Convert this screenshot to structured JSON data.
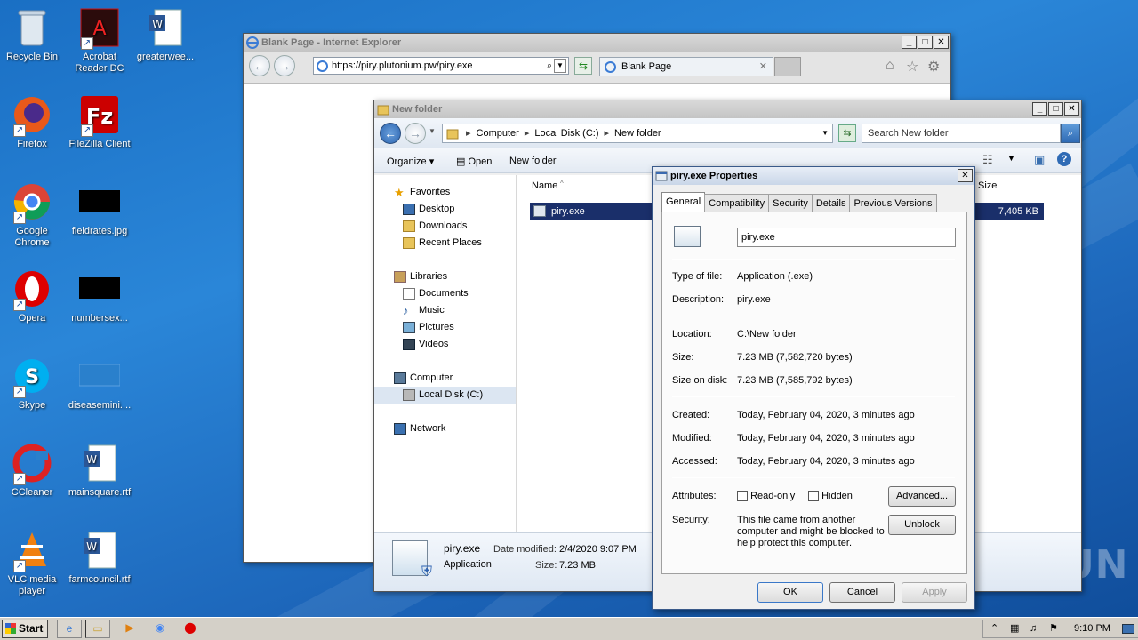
{
  "desktop": {
    "icons": [
      {
        "label": "Recycle Bin"
      },
      {
        "label": "Acrobat Reader DC"
      },
      {
        "label": "greaterwee..."
      },
      {
        "label": "Firefox"
      },
      {
        "label": "FileZilla Client"
      },
      {
        "label": "Google Chrome"
      },
      {
        "label": "fieldrates.jpg"
      },
      {
        "label": "Opera"
      },
      {
        "label": "numbersex..."
      },
      {
        "label": "Skype"
      },
      {
        "label": "diseasemini...."
      },
      {
        "label": "CCleaner"
      },
      {
        "label": "mainsquare.rtf"
      },
      {
        "label": "VLC media player"
      },
      {
        "label": "farmcouncil.rtf"
      }
    ],
    "watermark": "ANY RUN"
  },
  "ie": {
    "title": "Blank Page - Internet Explorer",
    "url": "https://piry.plutonium.pw/piry.exe",
    "tab_label": "Blank Page"
  },
  "explorer": {
    "title": "New folder",
    "breadcrumb": [
      "Computer",
      "Local Disk (C:)",
      "New folder"
    ],
    "search_placeholder": "Search New folder",
    "commands": {
      "organize": "Organize",
      "open": "Open",
      "new_folder": "New folder"
    },
    "nav": {
      "favorites": "Favorites",
      "desktop": "Desktop",
      "downloads": "Downloads",
      "recent": "Recent Places",
      "libraries": "Libraries",
      "documents": "Documents",
      "music": "Music",
      "pictures": "Pictures",
      "videos": "Videos",
      "computer": "Computer",
      "local_disk": "Local Disk (C:)",
      "network": "Network"
    },
    "columns": {
      "name": "Name",
      "size": "Size"
    },
    "file": {
      "name": "piry.exe",
      "size": "7,405 KB"
    },
    "details": {
      "name": "piry.exe",
      "type": "Application",
      "modified_label": "Date modified:",
      "modified": "2/4/2020 9:07 PM",
      "size_label": "Size:",
      "size": "7.23 MB"
    }
  },
  "props": {
    "title": "piry.exe Properties",
    "tabs": [
      "General",
      "Compatibility",
      "Security",
      "Details",
      "Previous Versions"
    ],
    "filename": "piry.exe",
    "type_label": "Type of file:",
    "type": "Application (.exe)",
    "desc_label": "Description:",
    "desc": "piry.exe",
    "location_label": "Location:",
    "location": "C:\\New folder",
    "size_label": "Size:",
    "size": "7.23 MB (7,582,720 bytes)",
    "disk_label": "Size on disk:",
    "disk": "7.23 MB (7,585,792 bytes)",
    "created_label": "Created:",
    "created": "Today, February 04, 2020, 3 minutes ago",
    "modified_label": "Modified:",
    "modified": "Today, February 04, 2020, 3 minutes ago",
    "accessed_label": "Accessed:",
    "accessed": "Today, February 04, 2020, 3 minutes ago",
    "attributes_label": "Attributes:",
    "readonly": "Read-only",
    "hidden": "Hidden",
    "advanced": "Advanced...",
    "security_label": "Security:",
    "security_text_1": "This file came from another",
    "security_text_2": "computer and might be blocked to",
    "security_text_3": "help protect this computer.",
    "unblock": "Unblock",
    "ok": "OK",
    "cancel": "Cancel",
    "apply": "Apply"
  },
  "taskbar": {
    "start": "Start",
    "time": "9:10 PM"
  }
}
